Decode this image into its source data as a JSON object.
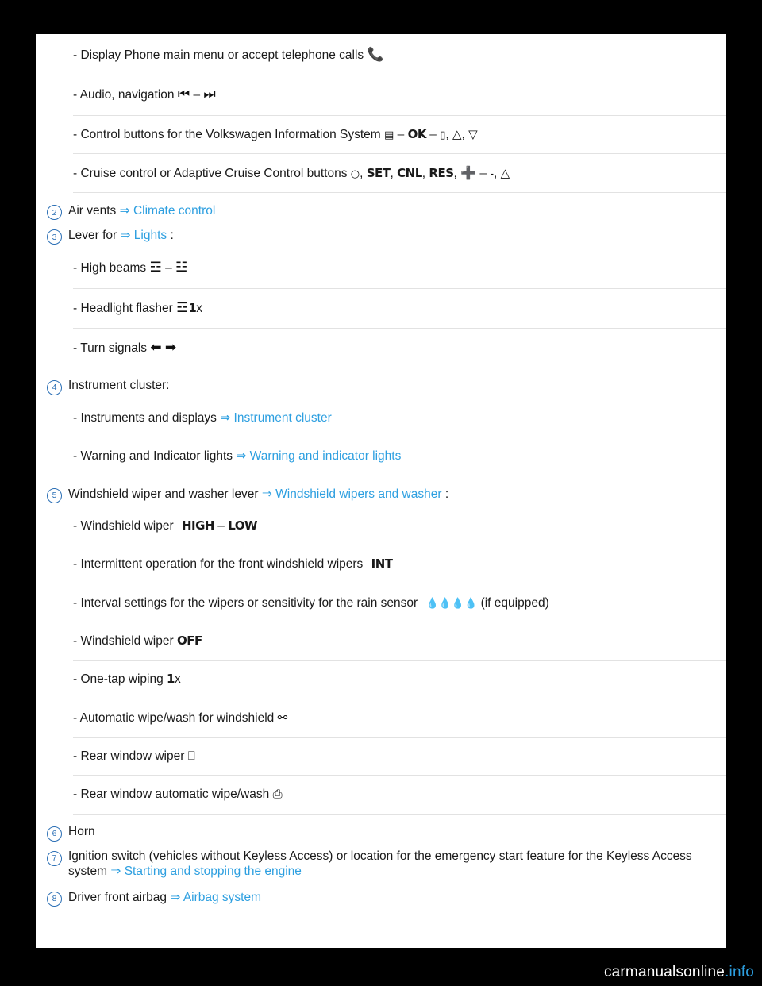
{
  "document": {
    "rows": [
      {
        "type": "sub",
        "text": "- Display Phone main menu or accept telephone calls",
        "icons": [
          "phone-handset"
        ]
      },
      {
        "type": "sub",
        "text": "- Audio, navigation",
        "icons": [
          "skip-previous",
          "dash",
          "skip-next"
        ]
      },
      {
        "type": "sub",
        "text": "- Control buttons for the Volkswagen Information System",
        "icons": [
          "menu-small",
          "dash",
          "OK",
          "dash",
          "back",
          "comma",
          "triangle-up",
          "comma",
          "triangle-down"
        ]
      },
      {
        "type": "sub",
        "text": "- Cruise control or Adaptive Cruise Control buttons",
        "icons": [
          "speed-0-1",
          "comma",
          "SET",
          "comma",
          "CNL",
          "comma",
          "RES",
          "comma",
          "plus",
          "dash",
          "minus",
          "comma",
          "distance"
        ]
      },
      {
        "type": "main",
        "num": "2",
        "text": "Air vents",
        "arrow": "⇒",
        "link": "Climate control",
        "after": ""
      },
      {
        "type": "main",
        "num": "3",
        "text": "Lever for",
        "arrow": "⇒",
        "link": "Lights",
        "after": ":"
      },
      {
        "type": "sub",
        "text": "- High beams",
        "icons": [
          "highbeam",
          "dash",
          "lowbeam"
        ]
      },
      {
        "type": "sub",
        "text": "- Headlight flasher",
        "icons": [
          "highbeam-1x"
        ]
      },
      {
        "type": "sub",
        "text": "- Turn signals",
        "icons": [
          "turn-left",
          "turn-right"
        ]
      },
      {
        "type": "main",
        "num": "4",
        "text": "Instrument cluster:",
        "arrow": "",
        "link": "",
        "after": ""
      },
      {
        "type": "sub",
        "text": "- Instruments and displays",
        "arrow": "⇒",
        "link": "Instrument cluster"
      },
      {
        "type": "sub",
        "text": "- Warning and Indicator lights",
        "arrow": "⇒",
        "link": "Warning and indicator lights"
      },
      {
        "type": "main",
        "num": "5",
        "text": "Windshield wiper and washer lever",
        "arrow": "⇒",
        "link": "Windshield wipers and washer",
        "after": ":"
      },
      {
        "type": "sub",
        "text": "- Windshield wiper",
        "icons": [
          "HIGH",
          "dash",
          "LOW"
        ]
      },
      {
        "type": "sub",
        "text": "- Intermittent operation for the front windshield wipers",
        "icons": [
          "INT"
        ]
      },
      {
        "type": "sub",
        "text": "- Interval settings for the wipers or sensitivity for the rain sensor",
        "icons": [
          "drops"
        ],
        "tail": "(if equipped)"
      },
      {
        "type": "sub",
        "text": "- Windshield wiper",
        "icons": [
          "OFF"
        ]
      },
      {
        "type": "sub",
        "text": "- One-tap wiping",
        "icons": [
          "one-tap-1x"
        ]
      },
      {
        "type": "sub",
        "text": "- Automatic wipe/wash for windshield",
        "icons": [
          "front-wash"
        ]
      },
      {
        "type": "sub",
        "text": "- Rear window wiper",
        "icons": [
          "rear-wiper"
        ]
      },
      {
        "type": "sub",
        "text": "- Rear window automatic wipe/wash",
        "icons": [
          "rear-wash"
        ]
      },
      {
        "type": "main",
        "num": "6",
        "text": "Horn",
        "arrow": "",
        "link": "",
        "after": ""
      },
      {
        "type": "main-wrap",
        "num": "7",
        "text": "Ignition switch (vehicles without Keyless Access) or location for the emergency start feature for the Keyless Access system",
        "arrow": "⇒",
        "link": "Starting and stopping the engine",
        "after": ""
      },
      {
        "type": "main",
        "num": "8",
        "text": "Driver front airbag",
        "arrow": "⇒",
        "link": "Airbag system",
        "after": ""
      }
    ]
  },
  "watermark": {
    "text_dark": "carmanualsonline",
    "text_blue": ".info"
  },
  "colors": {
    "link": "#2d9fe0",
    "number_circle": "#2b6fb5",
    "page_background": "#ffffff",
    "outer_background": "#000000",
    "separator": "#e2e2e2"
  }
}
